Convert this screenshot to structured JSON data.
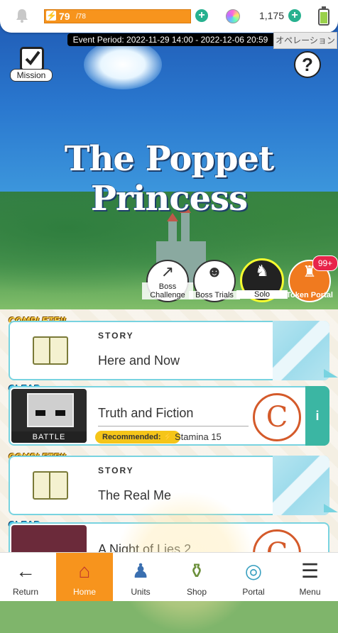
{
  "status_bar": {
    "stamina_current": "79",
    "stamina_max": "/78",
    "gems": "1,175"
  },
  "event": {
    "period": "Event Period: 2022-11-29 14:00 - 2022-12-06 20:59",
    "operation_button": "オペレーション"
  },
  "header": {
    "mission_label": "Mission",
    "help_label": "?",
    "title": "The Poppet Princess"
  },
  "modes": [
    {
      "label": "Boss Challenge"
    },
    {
      "label": "Boss Trials"
    },
    {
      "label": "Solo"
    },
    {
      "label": "Token Portal",
      "badge": "99+"
    }
  ],
  "chapters": [
    {
      "status": "COMPLETE!!",
      "kind": "STORY",
      "name": "Here and Now"
    },
    {
      "status": "CLEAR",
      "thumb_label": "BATTLE",
      "name": "Truth and Fiction",
      "recommended_label": "Recommended:",
      "stamina_label": "Stamina",
      "stamina_value": "15",
      "info": "i"
    },
    {
      "status": "COMPLETE!!",
      "kind": "STORY",
      "name": "The Real Me"
    },
    {
      "status": "CLEAR",
      "name": "A Night of Lies 2"
    }
  ],
  "nav": [
    {
      "label": "Return",
      "icon": "back-arrow-icon"
    },
    {
      "label": "Home",
      "icon": "home-icon"
    },
    {
      "label": "Units",
      "icon": "units-icon"
    },
    {
      "label": "Shop",
      "icon": "shop-icon"
    },
    {
      "label": "Portal",
      "icon": "portal-icon"
    },
    {
      "label": "Menu",
      "icon": "menu-icon"
    }
  ],
  "colors": {
    "accent": "#f7941d",
    "teal": "#27b18f",
    "card_border": "#78d3e0"
  }
}
